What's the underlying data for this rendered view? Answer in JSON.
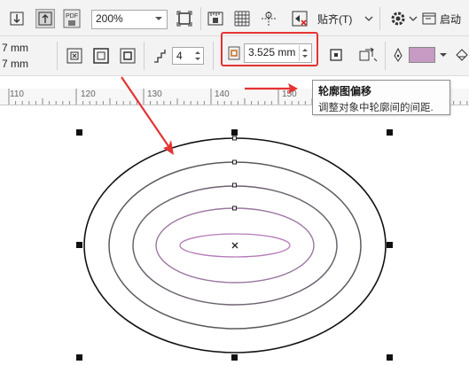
{
  "toolbar_top": {
    "zoom_value": "200%",
    "snap_label": "贴齐(T)",
    "launch_label": "启动"
  },
  "toolbar_props": {
    "size_width": "7 mm",
    "size_height": "7 mm",
    "contour_steps": "4",
    "contour_offset": "3.525 mm",
    "fill_color": "#c79ac4"
  },
  "ruler": {
    "labels": [
      "110",
      "120",
      "130",
      "140",
      "150"
    ]
  },
  "tooltip": {
    "title": "轮廓图偏移",
    "description": "调整对象中轮廓间的间距."
  },
  "colors": {
    "highlight": "#e53333",
    "arrow": "#e53333",
    "outer_contour": "#111111",
    "mid_contour": "#5a5a5a",
    "inner_contour": "#b57bb8"
  }
}
